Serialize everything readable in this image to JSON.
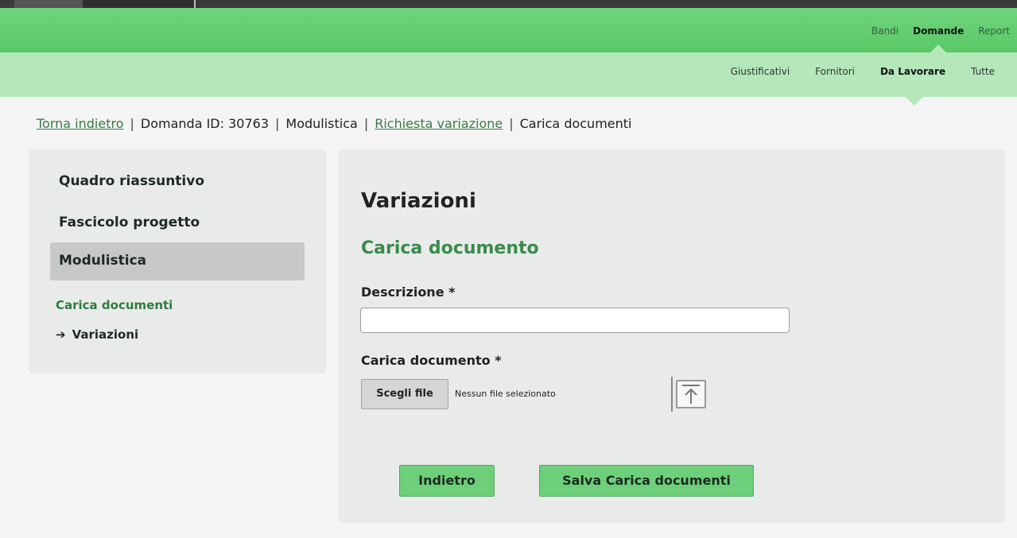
{
  "nav_primary": {
    "items": [
      {
        "label": "Bandi",
        "active": false
      },
      {
        "label": "Domande",
        "active": true
      },
      {
        "label": "Report",
        "active": false
      }
    ]
  },
  "nav_secondary": {
    "items": [
      {
        "label": "Giustificativi",
        "active": false
      },
      {
        "label": "Fornitori",
        "active": false
      },
      {
        "label": "Da Lavorare",
        "active": true
      },
      {
        "label": "Tutte",
        "active": false
      }
    ]
  },
  "breadcrumb": {
    "back": "Torna indietro",
    "domanda": "Domanda ID: 30763",
    "modulistica": "Modulistica",
    "richiesta": "Richiesta variazione",
    "current": "Carica documenti",
    "separator": "|"
  },
  "sidebar": {
    "items": [
      {
        "label": "Quadro riassuntivo"
      },
      {
        "label": "Fascicolo progetto"
      },
      {
        "label": "Modulistica",
        "active": true
      }
    ],
    "section_title": "Carica documenti",
    "sub_item": {
      "arrow": "➔",
      "label": "Variazioni"
    }
  },
  "main": {
    "title": "Variazioni",
    "subtitle": "Carica documento",
    "description_label": "Descrizione *",
    "description_value": "",
    "upload_label": "Carica documento *",
    "file_button": "Scegli file",
    "file_status": "Nessun file selezionato",
    "back_button": "Indietro",
    "save_button": "Salva Carica documenti"
  },
  "colors": {
    "nav_primary": "#5fcb6c",
    "nav_secondary": "#b4e8bb",
    "accent_green": "#3b8b4b",
    "button_green": "#6ecf7b"
  },
  "icons": {
    "upload": "upload-arrow-icon",
    "sub_item_arrow": "arrow-right-icon"
  }
}
